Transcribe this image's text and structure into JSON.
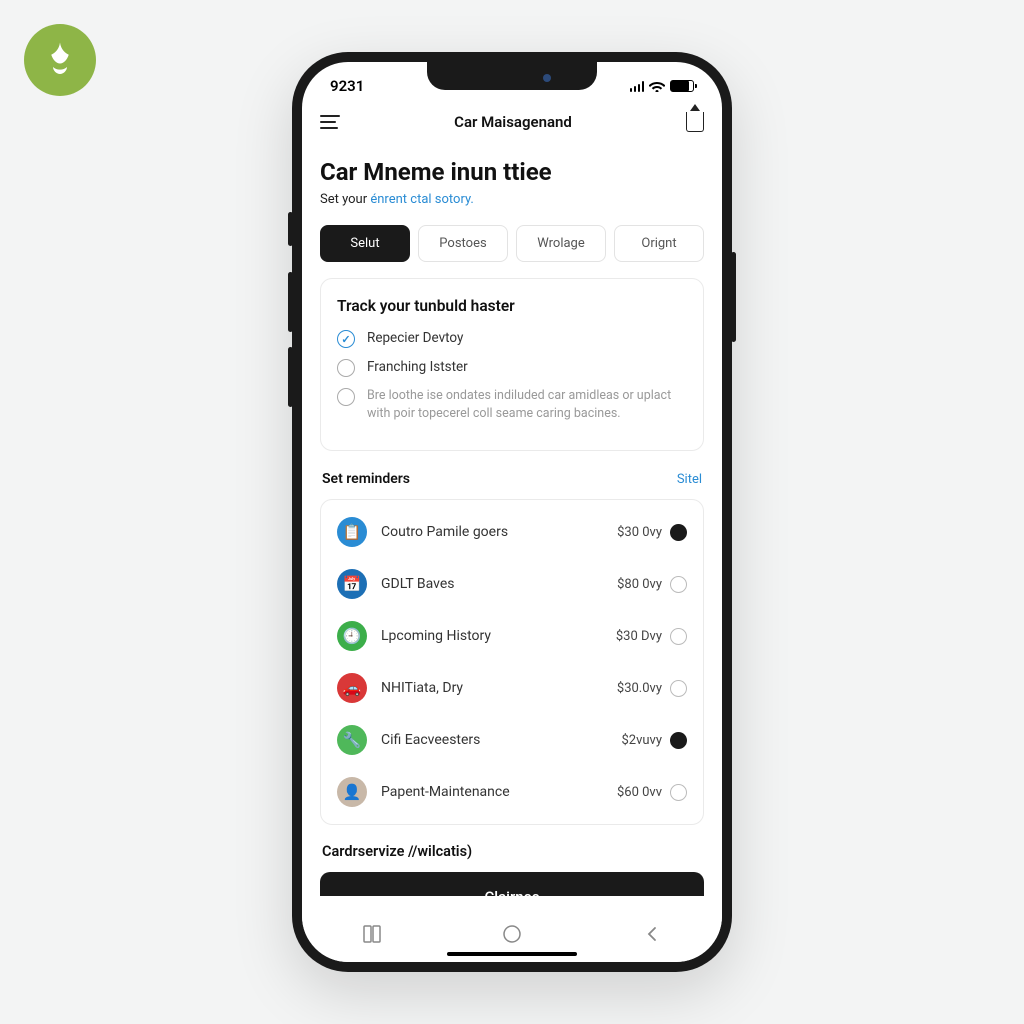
{
  "statusbar": {
    "time": "9231"
  },
  "navbar": {
    "title": "Car Maisagenand"
  },
  "page": {
    "title": "Car Mneme inun ttiee",
    "subtitle_prefix": "Set your ",
    "subtitle_link": "énrent ctal sotory."
  },
  "tabs": [
    {
      "label": "Selut",
      "active": true
    },
    {
      "label": "Postoes",
      "active": false
    },
    {
      "label": "Wrolage",
      "active": false
    },
    {
      "label": "Orignt",
      "active": false
    }
  ],
  "track_card": {
    "title": "Track your tunbuld haster",
    "options": [
      {
        "label": "Repecier Devtoy",
        "selected": true
      },
      {
        "label": "Franching Istster",
        "selected": false
      },
      {
        "label": "Bre loothe ise ondates indiluded car amidleas or uplact with poir topecerel coll seame caring bacines.",
        "selected": false,
        "dim": true
      }
    ]
  },
  "reminders": {
    "title": "Set reminders",
    "action": "Sitel",
    "items": [
      {
        "icon": "clipboard",
        "color": "blue",
        "label": "Coutro Pamile goers",
        "value": "$30 0vy",
        "on": true
      },
      {
        "icon": "calendar",
        "color": "dblue",
        "label": "GDLT Baves",
        "value": "$80 0vy",
        "on": false
      },
      {
        "icon": "history",
        "color": "green",
        "label": "Lpcoming History",
        "value": "$30 Dvy",
        "on": false
      },
      {
        "icon": "car",
        "color": "red",
        "label": "NHITiata, Dry",
        "value": "$30.0vy",
        "on": false
      },
      {
        "icon": "wrench",
        "color": "lgreen",
        "label": "Cifi Eacveesters",
        "value": "$2vuvy",
        "on": true
      },
      {
        "icon": "avatar",
        "color": "avatar",
        "label": "Papent-Maintenance",
        "value": "$60 0vv",
        "on": false
      }
    ]
  },
  "bottom": {
    "section_label": "Cardrservize //wilcatis)",
    "cta": "Clairnce"
  }
}
